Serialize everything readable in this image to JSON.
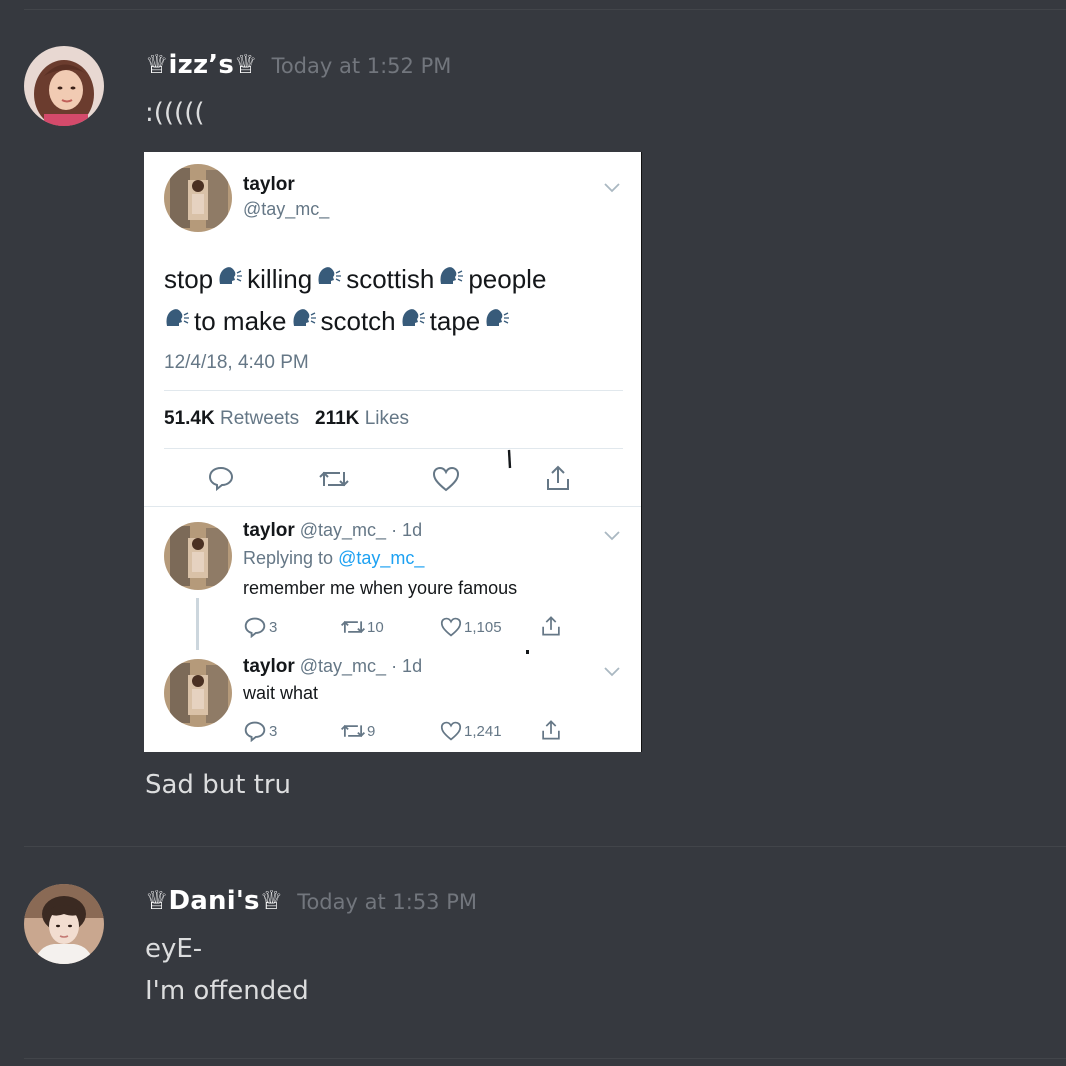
{
  "messages": [
    {
      "username": "♕izz’s♕",
      "timestamp": "Today at 1:52 PM",
      "lines": [
        ":(((((",
        "Sad but tru"
      ]
    },
    {
      "username": "♕Dani's♕",
      "timestamp": "Today at 1:53 PM",
      "lines": [
        "eyE-",
        "I'm offended"
      ]
    }
  ],
  "embed": {
    "tweet": {
      "name": "taylor",
      "handle": "@tay_mc_",
      "text_words_line1": [
        "stop",
        "killing",
        "scottish",
        "people"
      ],
      "text_words_line2": [
        "to make",
        "scotch",
        "tape"
      ],
      "date": "12/4/18, 4:40 PM",
      "retweets_count": "51.4K",
      "retweets_label": "Retweets",
      "likes_count": "211K",
      "likes_label": "Likes"
    },
    "replies": [
      {
        "name": "taylor",
        "handle_meta": "@tay_mc_ · 1d",
        "replying_prefix": "Replying to",
        "replying_to": "@tay_mc_",
        "text": "remember me when youre famous",
        "replies": "3",
        "retweets": "10",
        "likes": "1,105"
      },
      {
        "name": "taylor",
        "handle_meta": "@tay_mc_ · 1d",
        "text": "wait what",
        "replies": "3",
        "retweets": "9",
        "likes": "1,241"
      }
    ]
  },
  "colors": {
    "background": "#36393f",
    "username": "#ffffff",
    "timestamp": "#72767d",
    "message_text": "#dcddde",
    "twitter_link": "#1da1f2"
  },
  "icons": [
    "crown-icon",
    "chevron-down-icon",
    "speaking-head-icon",
    "reply-icon",
    "retweet-icon",
    "like-icon",
    "share-icon"
  ]
}
